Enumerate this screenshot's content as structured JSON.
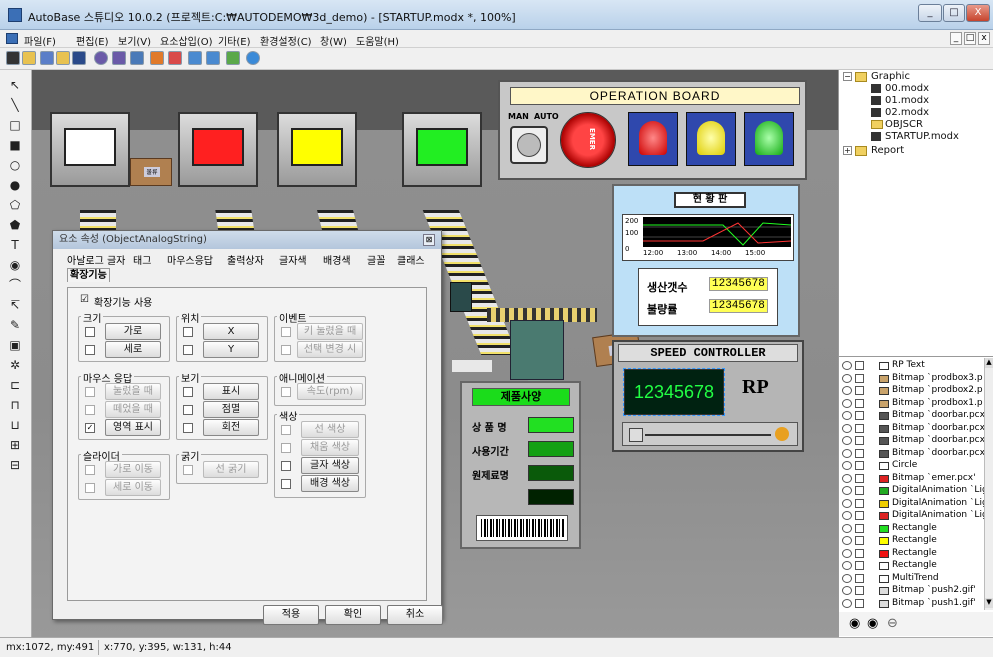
{
  "window": {
    "title": "AutoBase 스튜디오 10.0.2 (프로젝트:C:₩AUTODEMO₩3d_demo) - [STARTUP.modx *, 100%]",
    "controls": {
      "minimize": "_",
      "maximize": "□",
      "close": "X"
    },
    "doc_controls": {
      "minimize": "_",
      "restore": "□",
      "close": "x"
    }
  },
  "menu": [
    "파일(F)",
    "편집(E)",
    "보기(V)",
    "요소삽입(O)",
    "기타(E)",
    "환경설정(C)",
    "창(W)",
    "도움말(H)"
  ],
  "toolbar": {
    "icons": [
      "new-icon",
      "open-icon",
      "save-as-icon",
      "folder-icon",
      "save-icon",
      "dollar-icon",
      "dollar2-icon",
      "tree-icon",
      "rocket-icon",
      "palette-icon",
      "grid-icon",
      "panel-icon",
      "image-icon",
      "globe-icon"
    ]
  },
  "left_tools": {
    "icons": [
      {
        "name": "arrow-tool-icon",
        "glyph": "↖"
      },
      {
        "name": "line-tool-icon",
        "glyph": "╲"
      },
      {
        "name": "rectangle-tool-icon",
        "glyph": "□"
      },
      {
        "name": "filled-rectangle-tool-icon",
        "glyph": "■"
      },
      {
        "name": "circle-tool-icon",
        "glyph": "○"
      },
      {
        "name": "filled-circle-tool-icon",
        "glyph": "●"
      },
      {
        "name": "polygon-tool-icon",
        "glyph": "⬠"
      },
      {
        "name": "filled-polygon-tool-icon",
        "glyph": "⬟"
      },
      {
        "name": "text-tool-icon",
        "glyph": "T"
      },
      {
        "name": "round-tool-icon",
        "glyph": "◉"
      },
      {
        "name": "arc-tool-icon",
        "glyph": "⌒"
      },
      {
        "name": "arrow-select-tool-icon",
        "glyph": "↸"
      },
      {
        "name": "pen-tool-icon",
        "glyph": "✎"
      },
      {
        "name": "block-tool-icon",
        "glyph": "▣"
      },
      {
        "name": "gear-tool-icon",
        "glyph": "✲"
      },
      {
        "name": "align-left-tool-icon",
        "glyph": "⊏"
      },
      {
        "name": "align-top-tool-icon",
        "glyph": "⊓"
      },
      {
        "name": "align-bottom-tool-icon",
        "glyph": "⊔"
      },
      {
        "name": "align-center-tool-icon",
        "glyph": "⊞"
      },
      {
        "name": "align-mid-tool-icon",
        "glyph": "⊟"
      }
    ]
  },
  "canvas": {
    "operation_board": {
      "title": "OPERATION BOARD",
      "man_label": "MAN",
      "auto_label": "AUTO",
      "emer_label": "EMER"
    },
    "status_board": {
      "title": "현 황 판",
      "trend_y_ticks": [
        "200",
        "100",
        "0"
      ],
      "trend_x_ticks": [
        "12:00",
        "13:00",
        "14:00",
        "15:00"
      ],
      "production_label": "생산갯수",
      "production_value": "12345678",
      "defect_label": "불량률",
      "defect_value": "12345678"
    },
    "speed_controller": {
      "title": "SPEED CONTROLLER",
      "value": "12345678",
      "unit": "RP"
    },
    "spec_panel": {
      "title": "제품사양",
      "rows": [
        "상 품 명",
        "사용기간",
        "원제료명"
      ]
    },
    "door_colors": [
      "#ffffff",
      "#ff2020",
      "#ffff00",
      "#22ee22"
    ],
    "box_label": "물류"
  },
  "dialog": {
    "title": "요소 속성 (ObjectAnalogString)",
    "close": "⊠",
    "tabs": [
      "아날로그 글자",
      "태그",
      "마우스응답",
      "출력상자",
      "글자색",
      "배경색",
      "글꼴",
      "클래스",
      "확장기능"
    ],
    "enable_label": "확장기능 사용",
    "enable_checked": "☑",
    "groups": {
      "size": {
        "label": "크기",
        "buttons": [
          "가로",
          "세로"
        ]
      },
      "position": {
        "label": "위치",
        "buttons": [
          "X",
          "Y"
        ]
      },
      "event": {
        "label": "이벤트",
        "buttons": [
          "키 눌렸을 때",
          "선택 변경 시"
        ]
      },
      "mouse": {
        "label": "마우스 응답",
        "buttons": [
          "눌렀을 때",
          "떼었을 때",
          "영역 표시"
        ],
        "checked": "✓"
      },
      "view": {
        "label": "보기",
        "buttons": [
          "표시",
          "점멸",
          "회전"
        ]
      },
      "animation": {
        "label": "애니메이션",
        "buttons": [
          "속도(rpm)"
        ]
      },
      "slider": {
        "label": "슬라이더",
        "buttons": [
          "가로 이동",
          "세로 이동"
        ]
      },
      "thickness": {
        "label": "굵기",
        "buttons": [
          "선 굵기"
        ]
      },
      "color": {
        "label": "색상",
        "buttons": [
          "선 색상",
          "채움 색상",
          "글자 색상",
          "배경 색상"
        ]
      }
    },
    "footer": {
      "apply": "적용",
      "ok": "확인",
      "cancel": "취소"
    }
  },
  "tree": {
    "root": "Graphic",
    "items": [
      "00.modx",
      "01.modx",
      "02.modx",
      "OBJSCR",
      "STARTUP.modx"
    ],
    "report": "Report"
  },
  "object_list": [
    {
      "label": "RP Text",
      "color": "#ffffff"
    },
    {
      "label": "Bitmap `prodbox3.p",
      "color": "#c9a36b"
    },
    {
      "label": "Bitmap `prodbox2.p",
      "color": "#c9a36b"
    },
    {
      "label": "Bitmap `prodbox1.p",
      "color": "#c9a36b"
    },
    {
      "label": "Bitmap `doorbar.pcx",
      "color": "#555555"
    },
    {
      "label": "Bitmap `doorbar.pcx",
      "color": "#555555"
    },
    {
      "label": "Bitmap `doorbar.pcx",
      "color": "#555555"
    },
    {
      "label": "Bitmap `doorbar.pcx",
      "color": "#555555"
    },
    {
      "label": "Circle",
      "color": "#ffffff"
    },
    {
      "label": "Bitmap `emer.pcx'",
      "color": "#dd2222"
    },
    {
      "label": "DigitalAnimation `Lig",
      "color": "#22aa22"
    },
    {
      "label": "DigitalAnimation `Lig",
      "color": "#eecc00"
    },
    {
      "label": "DigitalAnimation `Lig",
      "color": "#dd2222"
    },
    {
      "label": "Rectangle",
      "color": "#22dd22"
    },
    {
      "label": "Rectangle",
      "color": "#ffff00"
    },
    {
      "label": "Rectangle",
      "color": "#ee1111"
    },
    {
      "label": "Rectangle",
      "color": "#ffffff"
    },
    {
      "label": "MultiTrend",
      "color": "#ffffff"
    },
    {
      "label": "Bitmap `push2.gif'",
      "color": "#dddddd"
    },
    {
      "label": "Bitmap `push1.gif'",
      "color": "#dddddd"
    }
  ],
  "panel_buttons": [
    "◉",
    "◉",
    "⊖"
  ],
  "status": {
    "mouse": "mx:1072, my:491",
    "selection": "x:770, y:395, w:131, h:44"
  }
}
